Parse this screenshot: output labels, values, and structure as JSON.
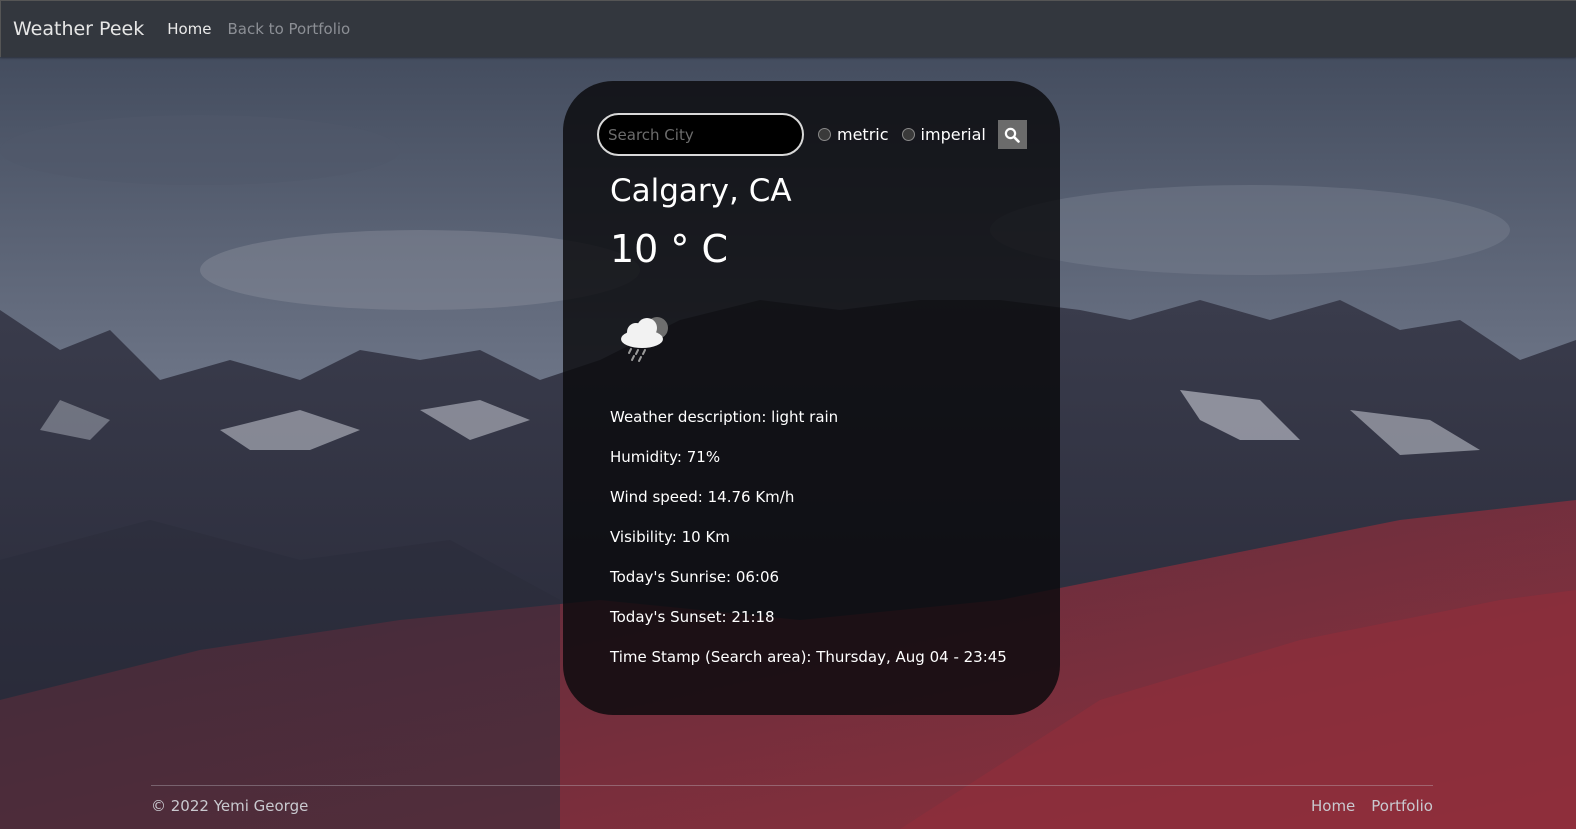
{
  "navbar": {
    "brand": "Weather Peek",
    "links": [
      "Home",
      "Back to Portfolio"
    ]
  },
  "search": {
    "placeholder": "Search City",
    "value": "",
    "unit_options": [
      "metric",
      "imperial"
    ],
    "selected_unit": null,
    "button_icon": "search-icon"
  },
  "weather": {
    "city": "Calgary, CA",
    "temperature": "10 ° C",
    "icon": "cloud-rain-icon",
    "details": [
      "Weather description: light rain",
      "Humidity: 71%",
      "Wind speed: 14.76 Km/h",
      "Visibility: 10 Km",
      "Today's Sunrise: 06:06",
      "Today's Sunset: 21:18",
      "Time Stamp (Search area): Thursday, Aug 04 - 23:45"
    ]
  },
  "footer": {
    "copyright": "© 2022 Yemi George",
    "links": [
      "Home",
      "Portfolio"
    ]
  },
  "colors": {
    "navbar": "#33373e",
    "card": "#0a0a0c",
    "search_button": "#6b6b6b"
  }
}
